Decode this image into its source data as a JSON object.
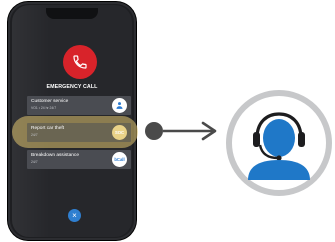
{
  "phone": {
    "title": "EMERGENCY CALL",
    "options": [
      {
        "label": "Customer service",
        "subtext": "VO1 • 24 hr 24/7",
        "badge": "",
        "highlighted": false
      },
      {
        "label": "Report car theft",
        "subtext": "24/7",
        "badge": "SOC",
        "highlighted": true
      },
      {
        "label": "Breakdown assistance",
        "subtext": "24/7",
        "badge": "bCall",
        "highlighted": false
      }
    ],
    "close_symbol": "×"
  },
  "icons": {
    "call": "phone-icon",
    "customer_service": "support-icon",
    "agent": "agent-headset-icon",
    "arrow": "arrow-right-icon"
  },
  "colors": {
    "call_red": "#d8232a",
    "accent_blue": "#2f7fd0",
    "highlight_gold": "#e0c470",
    "agent_blue": "#1f78c8",
    "ring_grey": "#c7c8ca"
  }
}
